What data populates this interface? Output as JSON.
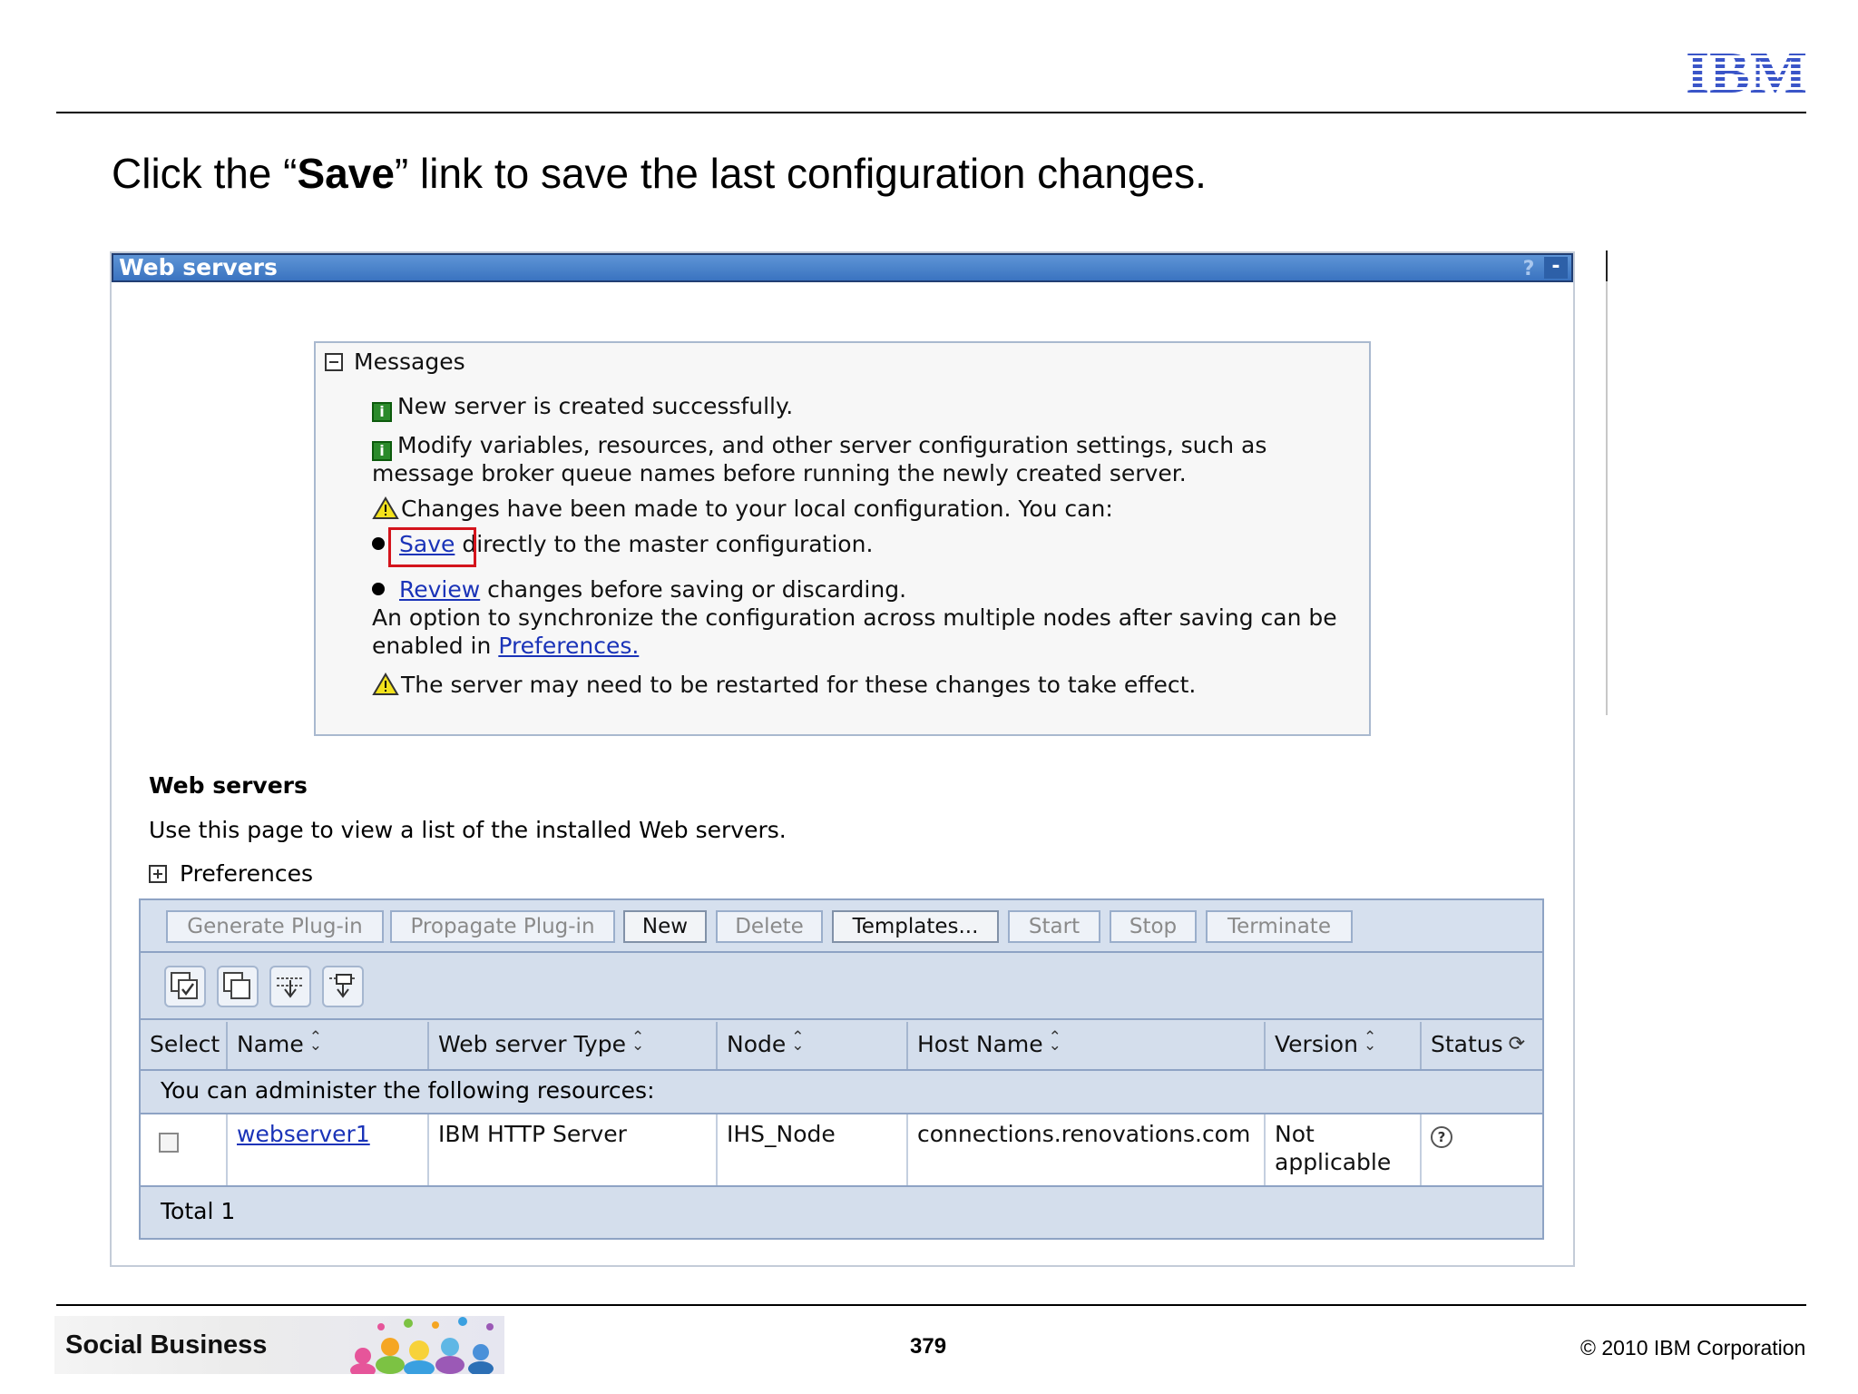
{
  "header": {
    "logo_text": "IBM",
    "instruction_pre": "Click the “",
    "instruction_bold": "Save",
    "instruction_post": "” link to save the last configuration changes."
  },
  "portlet": {
    "title": "Web servers",
    "help_label": "?",
    "minimize_label": "-"
  },
  "messages": {
    "heading": "Messages",
    "info1": "New server is created successfully.",
    "info2_line1": "Modify variables, resources, and other server configuration settings, such as",
    "info2_line2": "message broker queue names before running the newly created server.",
    "warn1": "Changes have been made to your local configuration. You can:",
    "save_link": "Save",
    "save_rest": "directly to the master configuration.",
    "review_link": "Review",
    "review_rest": "changes before saving or discarding.",
    "sync_line1": "An option to synchronize the configuration across multiple nodes after saving can be",
    "sync_pre": "enabled in",
    "preferences_link": "Preferences.",
    "warn2": "The server may need to be restarted for these changes to take effect."
  },
  "section": {
    "title": "Web servers",
    "description": "Use this page to view a list of the installed Web servers.",
    "preferences": "Preferences"
  },
  "toolbar": {
    "buttons": [
      {
        "label": "Generate Plug-in",
        "enabled": false
      },
      {
        "label": "Propagate Plug-in",
        "enabled": false
      },
      {
        "label": "New",
        "enabled": true
      },
      {
        "label": "Delete",
        "enabled": false
      },
      {
        "label": "Templates...",
        "enabled": true
      },
      {
        "label": "Start",
        "enabled": false
      },
      {
        "label": "Stop",
        "enabled": false
      },
      {
        "label": "Terminate",
        "enabled": false
      }
    ],
    "icons": [
      "select-all-icon",
      "deselect-all-icon",
      "expand-filter-icon",
      "clear-filter-icon"
    ]
  },
  "table": {
    "columns": [
      "Select",
      "Name",
      "Web server Type",
      "Node",
      "Host Name",
      "Version",
      "Status"
    ],
    "admin_text": "You can administer the following resources:",
    "rows": [
      {
        "name": "webserver1",
        "type": "IBM HTTP Server",
        "node": "IHS_Node",
        "host": "connections.renovations.com",
        "version_line1": "Not",
        "version_line2": "applicable",
        "status": "?"
      }
    ],
    "total": "Total 1"
  },
  "footer": {
    "banner": "Social Business",
    "page_number": "379",
    "copyright": "© 2010 IBM Corporation"
  },
  "colors": {
    "title_bar": "#3a73c0",
    "link": "#1a33b8",
    "highlight_box": "#d4141c",
    "table_bg": "#d4deec"
  }
}
